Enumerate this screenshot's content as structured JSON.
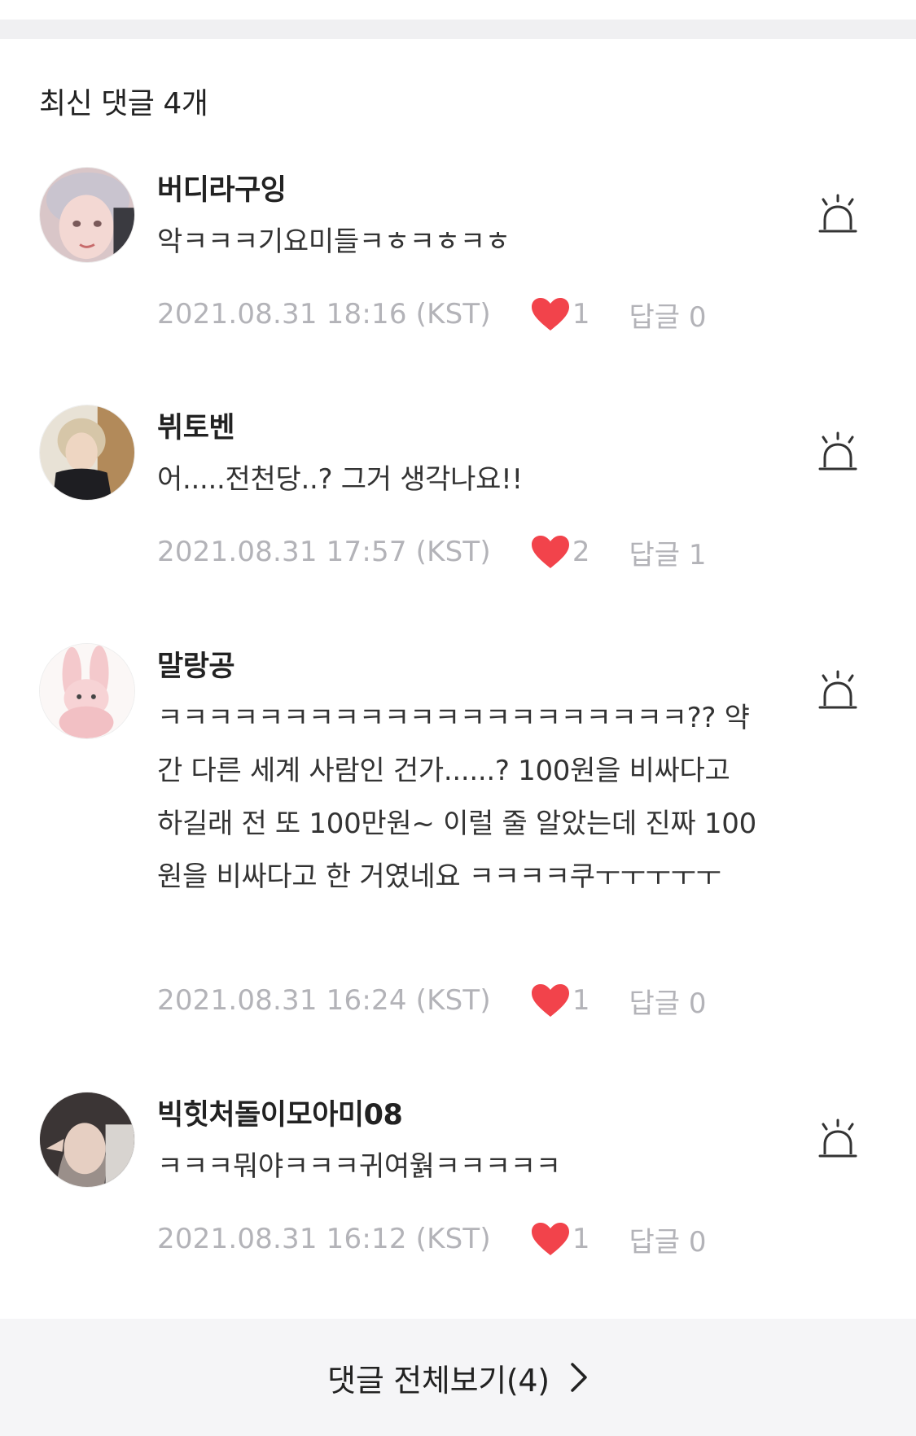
{
  "section": {
    "title": "최신 댓글 4개"
  },
  "comments": [
    {
      "nickname": "버디라구잉",
      "text": "악ㅋㅋㅋ기요미들ㅋㅎㅋㅎㅋㅎ",
      "date": "2021.08.31 18:16 (KST)",
      "likes": "1",
      "replies": "답글 0"
    },
    {
      "nickname": "뷔토벤",
      "text": "어.....전천당..? 그거 생각나요!!",
      "date": "2021.08.31 17:57 (KST)",
      "likes": "2",
      "replies": "답글 1"
    },
    {
      "nickname": "말랑공",
      "text": "ㅋㅋㅋㅋㅋㅋㅋㅋㅋㅋㅋㅋㅋㅋㅋㅋㅋㅋㅋㅋㅋ?? 약간 다른 세계 사람인 건가......? 100원을 비싸다고 하길래 전 또 100만원~ 이럴 줄 알았는데 진짜 100원을 비싸다고 한 거였네요 ㅋㅋㅋㅋ쿠ㅜㅜㅜㅜㅜ",
      "date": "2021.08.31 16:24 (KST)",
      "likes": "1",
      "replies": "답글 0"
    },
    {
      "nickname": "빅힛처돌이모아미08",
      "text": "ㅋㅋㅋ뭐야ㅋㅋㅋ귀여웕ㅋㅋㅋㅋㅋ",
      "date": "2021.08.31 16:12 (KST)",
      "likes": "1",
      "replies": "답글 0"
    }
  ],
  "footer": {
    "label": "댓글 전체보기(4)"
  },
  "icons": {
    "like": "heart-icon",
    "report": "alarm-icon",
    "more": "chevron-right-icon"
  },
  "colors": {
    "heart": "#f2434b",
    "meta": "#b3b3b8",
    "footer_bg": "#f5f5f7"
  }
}
